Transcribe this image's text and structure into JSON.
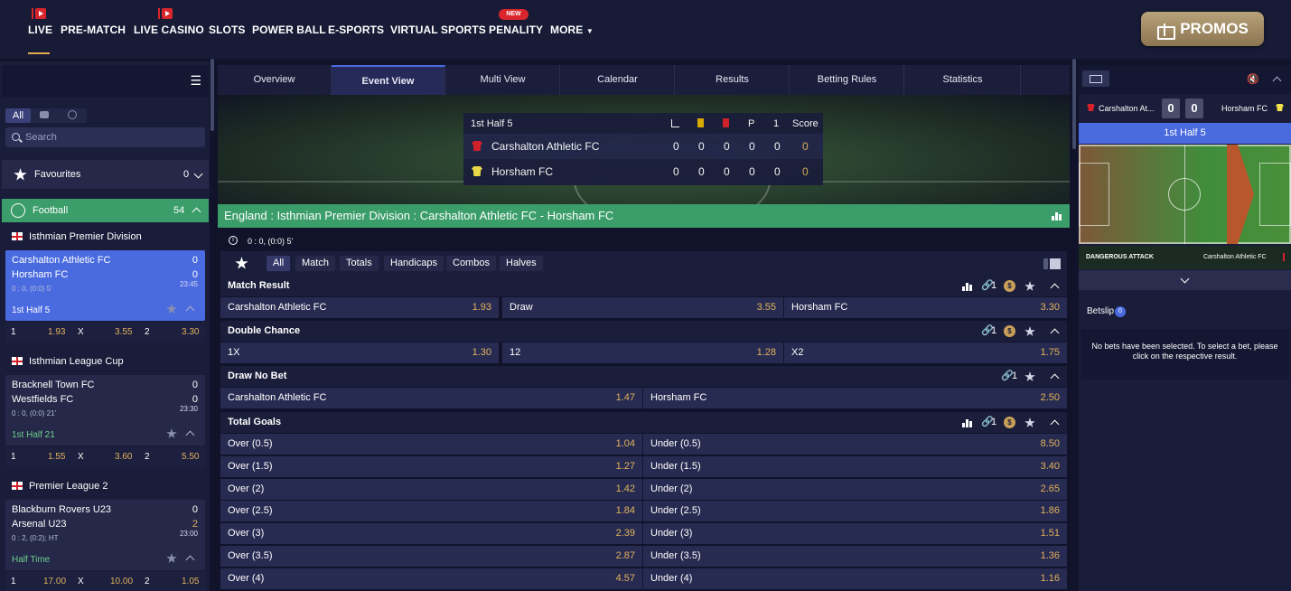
{
  "nav": {
    "items": [
      "LIVE",
      "PRE-MATCH",
      "LIVE CASINO",
      "SLOTS",
      "POWER BALL",
      "E-SPORTS",
      "VIRTUAL SPORTS",
      "PENALITY",
      "MORE"
    ],
    "new_badge": "NEW",
    "promos": "PROMOS"
  },
  "sidebar": {
    "filter_all": "All",
    "search_placeholder": "Search",
    "favourites": "Favourites",
    "favourites_count": "0",
    "sport": "Football",
    "sport_count": "54",
    "groups": [
      {
        "league": "Isthmian Premier Division",
        "home": "Carshalton Athletic FC",
        "home_score": "0",
        "away": "Horsham FC",
        "away_score": "0",
        "summary": "0 : 0, (0:0) 5'",
        "time": "23:45",
        "status": "1st Half 5",
        "odds": [
          "1",
          "1.93",
          "X",
          "3.55",
          "2",
          "3.30"
        ]
      },
      {
        "league": "Isthmian League Cup",
        "home": "Bracknell Town FC",
        "home_score": "0",
        "away": "Westfields FC",
        "away_score": "0",
        "summary": "0 : 0, (0:0) 21'",
        "time": "23:30",
        "status": "1st Half 21",
        "odds": [
          "1",
          "1.55",
          "X",
          "3.60",
          "2",
          "5.50"
        ]
      },
      {
        "league": "Premier League 2",
        "home": "Blackburn Rovers U23",
        "home_score": "0",
        "away": "Arsenal U23",
        "away_score": "2",
        "summary": "0 : 2, (0:2); HT",
        "time": "23:00",
        "status": "Half Time",
        "odds": [
          "1",
          "17.00",
          "X",
          "10.00",
          "2",
          "1.05"
        ]
      }
    ]
  },
  "tabs": [
    "Overview",
    "Event View",
    "Multi View",
    "Calendar",
    "Results",
    "Betting Rules",
    "Statistics"
  ],
  "scoreboard": {
    "period": "1st Half 5",
    "headers": [
      "P",
      "1",
      "Score"
    ],
    "home": {
      "name": "Carshalton Athletic FC",
      "stats": [
        "0",
        "0",
        "0",
        "0",
        "0",
        "0"
      ]
    },
    "away": {
      "name": "Horsham FC",
      "stats": [
        "0",
        "0",
        "0",
        "0",
        "0",
        "0"
      ]
    }
  },
  "event_title": "England : Isthmian Premier Division : Carshalton Athletic FC - Horsham FC",
  "event_info": "0 : 0, (0:0) 5'",
  "market_tabs": [
    "All",
    "Match",
    "Totals",
    "Handicaps",
    "Combos",
    "Halves"
  ],
  "markets": {
    "match_result": {
      "title": "Match Result",
      "links": "1",
      "cells": [
        [
          "Carshalton Athletic FC",
          "1.93"
        ],
        [
          "Draw",
          "3.55"
        ],
        [
          "Horsham FC",
          "3.30"
        ]
      ]
    },
    "double_chance": {
      "title": "Double Chance",
      "links": "1",
      "cells": [
        [
          "1X",
          "1.30"
        ],
        [
          "12",
          "1.28"
        ],
        [
          "X2",
          "1.75"
        ]
      ]
    },
    "draw_no_bet": {
      "title": "Draw No Bet",
      "links": "1",
      "cells": [
        [
          "Carshalton Athletic FC",
          "1.47"
        ],
        [
          "Horsham FC",
          "2.50"
        ]
      ]
    },
    "total_goals": {
      "title": "Total Goals",
      "links": "1",
      "rows": [
        [
          "Over (0.5)",
          "1.04",
          "Under (0.5)",
          "8.50"
        ],
        [
          "Over (1.5)",
          "1.27",
          "Under (1.5)",
          "3.40"
        ],
        [
          "Over (2)",
          "1.42",
          "Under (2)",
          "2.65"
        ],
        [
          "Over (2.5)",
          "1.84",
          "Under (2.5)",
          "1.86"
        ],
        [
          "Over (3)",
          "2.39",
          "Under (3)",
          "1.51"
        ],
        [
          "Over (3.5)",
          "2.87",
          "Under (3.5)",
          "1.36"
        ],
        [
          "Over (4)",
          "4.57",
          "Under (4)",
          "1.16"
        ]
      ]
    }
  },
  "tracker": {
    "home": "Carshalton At...",
    "home_score": "0",
    "away": "Horsham FC",
    "away_score": "0",
    "period": "1st Half 5",
    "event": "DANGEROUS ATTACK",
    "event_team": "Carshalton Athletic FC"
  },
  "betslip": {
    "title": "Betslip",
    "count": "0",
    "empty": "No bets have been selected. To select a bet, please click on the respective result."
  }
}
